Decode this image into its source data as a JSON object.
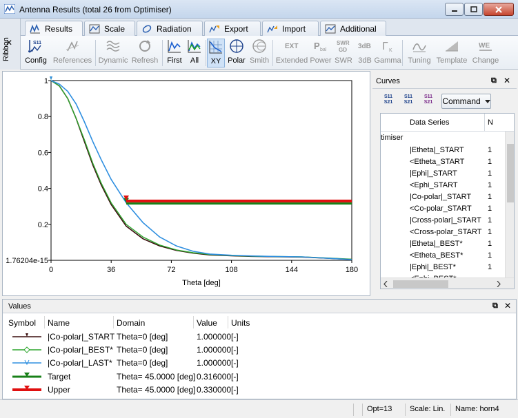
{
  "window": {
    "title": "Antenna Results (total 26 from Optimiser)"
  },
  "ribbon": {
    "label": "Ribbon",
    "tabs": [
      {
        "label": "Results",
        "icon": "results-icon"
      },
      {
        "label": "Scale",
        "icon": "scale-icon"
      },
      {
        "label": "Radiation",
        "icon": "radiation-icon"
      },
      {
        "label": "Export",
        "icon": "export-icon"
      },
      {
        "label": "Import",
        "icon": "import-icon"
      },
      {
        "label": "Additional",
        "icon": "additional-icon"
      }
    ],
    "buttons": [
      {
        "label": "Config",
        "enabled": true
      },
      {
        "label": "References",
        "enabled": false
      },
      {
        "label": "Dynamic",
        "enabled": false
      },
      {
        "label": "Refresh",
        "enabled": false
      },
      {
        "label": "First",
        "enabled": true
      },
      {
        "label": "All",
        "enabled": true
      },
      {
        "label": "XY",
        "enabled": true,
        "selected": true
      },
      {
        "label": "Polar",
        "enabled": true
      },
      {
        "label": "Smith",
        "enabled": false
      },
      {
        "label": "Extended",
        "enabled": false
      },
      {
        "label": "Power",
        "enabled": false
      },
      {
        "label": "SWR",
        "enabled": false
      },
      {
        "label": "3dB",
        "enabled": false
      },
      {
        "label": "Gamma",
        "enabled": false
      },
      {
        "label": "Tuning",
        "enabled": false
      },
      {
        "label": "Template",
        "enabled": false
      },
      {
        "label": "Change",
        "enabled": false
      }
    ],
    "icon_text": {
      "s11": "S11",
      "ext": "EXT",
      "pbal": "P",
      "pbal_sub": "bal",
      "swr": "SWR",
      "swr_sub": "GD",
      "db3": "3dB",
      "gamma": "Γ",
      "gamma_sub": "K",
      "we": "WE"
    }
  },
  "chart_data": {
    "type": "line",
    "xlabel": "Theta [deg]",
    "xticks": [
      0,
      36,
      72,
      108,
      144,
      180
    ],
    "yticks_labels": [
      "1.76204e-15",
      "0.2",
      "0.4",
      "0.6",
      "0.8",
      "1"
    ],
    "yticks": [
      0,
      0.2,
      0.4,
      0.6,
      0.8,
      1.0
    ],
    "xlim": [
      0,
      180
    ],
    "ylim": [
      0,
      1
    ],
    "series": [
      {
        "name": "|Co-polar|_START",
        "color": "#3b0f0f",
        "x": [
          0,
          5,
          10,
          15,
          20,
          25,
          30,
          36,
          45,
          55,
          65,
          75,
          85,
          95,
          108,
          120,
          135,
          150,
          165,
          180
        ],
        "y": [
          1.0,
          0.97,
          0.9,
          0.79,
          0.66,
          0.53,
          0.42,
          0.31,
          0.19,
          0.12,
          0.08,
          0.055,
          0.04,
          0.03,
          0.025,
          0.022,
          0.02,
          0.018,
          0.012,
          0.005
        ]
      },
      {
        "name": "|Co-polar|_BEST*",
        "color": "#2ea62e",
        "x": [
          0,
          5,
          10,
          15,
          20,
          25,
          30,
          36,
          45,
          55,
          65,
          75,
          85,
          95,
          108,
          120,
          135,
          150,
          165,
          180
        ],
        "y": [
          1.0,
          0.97,
          0.9,
          0.79,
          0.67,
          0.54,
          0.43,
          0.32,
          0.2,
          0.13,
          0.085,
          0.058,
          0.042,
          0.032,
          0.026,
          0.023,
          0.021,
          0.019,
          0.013,
          0.006
        ]
      },
      {
        "name": "|Co-polar|_LAST*",
        "color": "#2f8fe0",
        "x": [
          0,
          5,
          10,
          15,
          20,
          25,
          30,
          36,
          45,
          55,
          65,
          75,
          85,
          95,
          108,
          120,
          135,
          150,
          165,
          180
        ],
        "y": [
          1.0,
          0.98,
          0.94,
          0.87,
          0.77,
          0.66,
          0.56,
          0.45,
          0.32,
          0.21,
          0.13,
          0.08,
          0.05,
          0.035,
          0.028,
          0.024,
          0.021,
          0.019,
          0.012,
          0.004
        ]
      },
      {
        "name": "Target",
        "color": "#188018",
        "x": [
          45,
          180
        ],
        "y": [
          0.316,
          0.316
        ]
      },
      {
        "name": "Upper",
        "color": "#e01010",
        "x": [
          45,
          180
        ],
        "y": [
          0.33,
          0.33
        ]
      }
    ]
  },
  "curves": {
    "title": "Curves",
    "tool_icons": [
      "s11-s21-sort-icon",
      "s11-s21-compare-icon",
      "s11-s21-overlay-icon"
    ],
    "tool_text": [
      [
        "S11",
        "S21"
      ],
      [
        "S11",
        "S21"
      ],
      [
        "S11",
        "S21"
      ]
    ],
    "command_label": "Command",
    "columns": [
      "Data Series",
      "N"
    ],
    "group_label": "timiser",
    "rows": [
      {
        "name": "|Etheta|_START",
        "n": "1"
      },
      {
        "name": "<Etheta_START",
        "n": "1"
      },
      {
        "name": "|Ephi|_START",
        "n": "1"
      },
      {
        "name": "<Ephi_START",
        "n": "1"
      },
      {
        "name": "|Co-polar|_START",
        "n": "1"
      },
      {
        "name": "<Co-polar_START",
        "n": "1"
      },
      {
        "name": "|Cross-polar|_START",
        "n": "1"
      },
      {
        "name": "<Cross-polar_START",
        "n": "1"
      },
      {
        "name": "|Etheta|_BEST*",
        "n": "1"
      },
      {
        "name": "<Etheta_BEST*",
        "n": "1"
      },
      {
        "name": "|Ephi|_BEST*",
        "n": "1"
      },
      {
        "name": "<Ephi_BEST*",
        "n": ""
      }
    ]
  },
  "values": {
    "title": "Values",
    "headers": [
      "Symbol",
      "Name",
      "Domain",
      "Value",
      "Units"
    ],
    "rows": [
      {
        "name": "|Co-polar|_START",
        "domain": "Theta=0 [deg]",
        "value": "1.000000",
        "units": "[-]",
        "color": "#3b0f0f",
        "marker": "arrow"
      },
      {
        "name": "|Co-polar|_BEST*",
        "domain": "Theta=0 [deg]",
        "value": "1.000000",
        "units": "[-]",
        "color": "#2ea62e",
        "marker": "diamond"
      },
      {
        "name": "|Co-polar|_LAST*",
        "domain": "Theta=0 [deg]",
        "value": "1.000000",
        "units": "[-]",
        "color": "#2f8fe0",
        "marker": "v"
      },
      {
        "name": "Target",
        "domain": "Theta= 45.0000 [deg]",
        "value": "0.316000",
        "units": "[-]",
        "color": "#188018",
        "marker": "triangle"
      },
      {
        "name": "Upper",
        "domain": "Theta= 45.0000 [deg]",
        "value": "0.330000",
        "units": "[-]",
        "color": "#e01010",
        "marker": "triangle"
      }
    ]
  },
  "status": {
    "opt": "Opt=13",
    "scale": "Scale: Lin.",
    "name": "Name: horn4"
  }
}
